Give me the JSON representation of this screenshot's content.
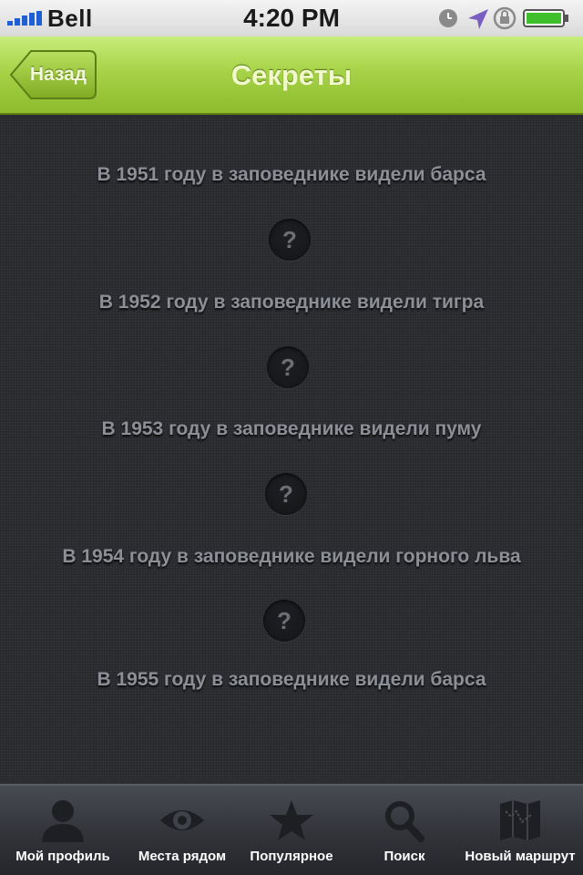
{
  "status_bar": {
    "carrier": "Bell",
    "time": "4:20 PM"
  },
  "nav_bar": {
    "back_label": "Назад",
    "title": "Секреты"
  },
  "secrets": [
    "В 1951 году в заповеднике видели барса",
    "В 1952 году в заповеднике видели тигра",
    "В 1953 году в заповеднике видели пуму",
    "В 1954 году в заповеднике видели горного льва",
    "В 1955 году в заповеднике видели барса"
  ],
  "question_mark": "?",
  "tab_bar": {
    "tabs": [
      {
        "label": "Мой профиль",
        "icon": "person-icon"
      },
      {
        "label": "Места рядом",
        "icon": "eye-icon"
      },
      {
        "label": "Популярное",
        "icon": "star-icon"
      },
      {
        "label": "Поиск",
        "icon": "search-icon"
      },
      {
        "label": "Новый маршрут",
        "icon": "map-icon"
      }
    ]
  },
  "colors": {
    "nav_green": "#a7d348",
    "content_background": "#2c2d31",
    "secret_text": "#8d8f96",
    "tab_bar": "#33353b"
  }
}
